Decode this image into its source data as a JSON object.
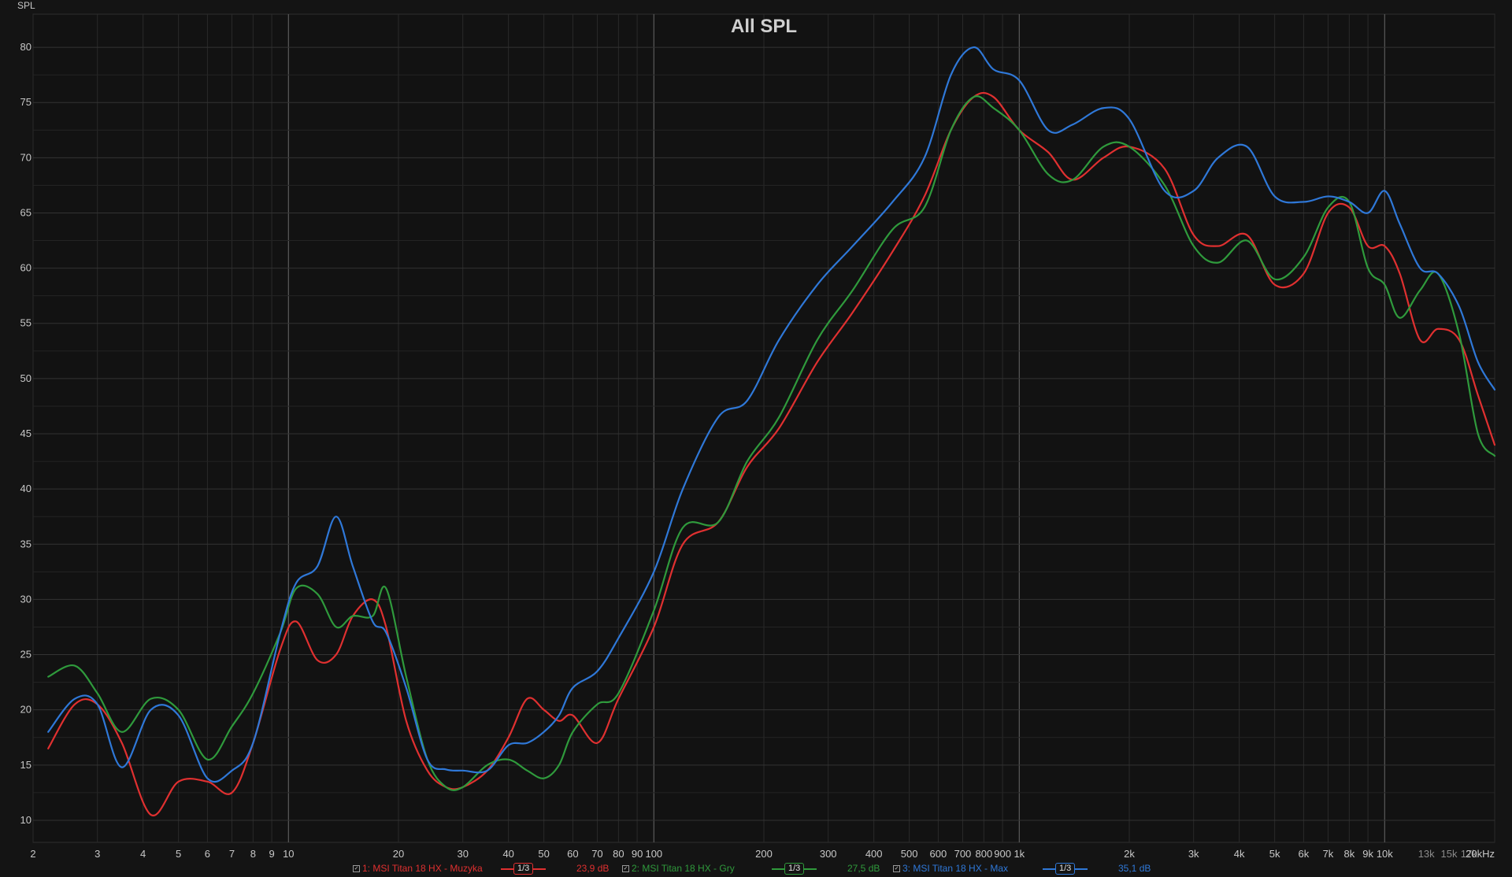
{
  "chart_data": {
    "type": "line",
    "title": "All SPL",
    "ylabel": "SPL",
    "xscale": "log",
    "xlim": [
      2,
      20000
    ],
    "ylim": [
      8,
      83
    ],
    "grid": true,
    "legend_position": "bottom",
    "yticks": [
      10,
      15,
      20,
      25,
      30,
      35,
      40,
      45,
      50,
      55,
      60,
      65,
      70,
      75,
      80
    ],
    "xticks": [
      {
        "v": 2,
        "t": "2"
      },
      {
        "v": 3,
        "t": "3"
      },
      {
        "v": 4,
        "t": "4"
      },
      {
        "v": 5,
        "t": "5"
      },
      {
        "v": 6,
        "t": "6"
      },
      {
        "v": 7,
        "t": "7"
      },
      {
        "v": 8,
        "t": "8"
      },
      {
        "v": 9,
        "t": "9"
      },
      {
        "v": 10,
        "t": "10"
      },
      {
        "v": 20,
        "t": "20"
      },
      {
        "v": 30,
        "t": "30"
      },
      {
        "v": 40,
        "t": "40"
      },
      {
        "v": 50,
        "t": "50"
      },
      {
        "v": 60,
        "t": "60"
      },
      {
        "v": 70,
        "t": "70"
      },
      {
        "v": 80,
        "t": "80"
      },
      {
        "v": 90,
        "t": "90"
      },
      {
        "v": 100,
        "t": "100"
      },
      {
        "v": 200,
        "t": "200"
      },
      {
        "v": 300,
        "t": "300"
      },
      {
        "v": 400,
        "t": "400"
      },
      {
        "v": 500,
        "t": "500"
      },
      {
        "v": 600,
        "t": "600"
      },
      {
        "v": 700,
        "t": "700"
      },
      {
        "v": 800,
        "t": "800"
      },
      {
        "v": 900,
        "t": "900"
      },
      {
        "v": 1000,
        "t": "1k"
      },
      {
        "v": 2000,
        "t": "2k"
      },
      {
        "v": 3000,
        "t": "3k"
      },
      {
        "v": 4000,
        "t": "4k"
      },
      {
        "v": 5000,
        "t": "5k"
      },
      {
        "v": 6000,
        "t": "6k"
      },
      {
        "v": 7000,
        "t": "7k"
      },
      {
        "v": 8000,
        "t": "8k"
      },
      {
        "v": 9000,
        "t": "9k"
      },
      {
        "v": 10000,
        "t": "10k"
      },
      {
        "v": 13000,
        "t": "13k",
        "dim": true
      },
      {
        "v": 15000,
        "t": "15k",
        "dim": true
      },
      {
        "v": 17000,
        "t": "17k",
        "dim": true
      },
      {
        "v": 20000,
        "t": "20kHz"
      }
    ],
    "x": [
      2.2,
      2.6,
      3.0,
      3.5,
      4.2,
      5.0,
      6.0,
      7.0,
      8.0,
      9.5,
      10.5,
      12,
      13.5,
      15,
      17,
      18.5,
      21,
      24,
      27,
      30,
      35,
      40,
      45,
      50,
      55,
      60,
      70,
      80,
      100,
      120,
      150,
      180,
      220,
      280,
      350,
      450,
      550,
      650,
      750,
      850,
      1000,
      1200,
      1400,
      1700,
      2000,
      2500,
      3000,
      3500,
      4200,
      5000,
      6000,
      7000,
      8000,
      9000,
      10000,
      11000,
      12500,
      14000,
      16000,
      18000,
      20000
    ],
    "series": [
      {
        "name": "1: MSI Titan 18 HX - Muzyka",
        "color": "#e03030",
        "values": [
          16.5,
          20.5,
          20.5,
          17.0,
          10.5,
          13.5,
          13.5,
          12.5,
          17.0,
          25.5,
          28.0,
          24.5,
          25.0,
          28.5,
          30.0,
          27.5,
          19.0,
          14.5,
          13.0,
          13.0,
          14.5,
          17.5,
          21.0,
          20.0,
          19.0,
          19.5,
          17.0,
          21.0,
          27.5,
          35.0,
          37.0,
          42.0,
          45.5,
          51.5,
          56.0,
          61.5,
          66.5,
          72.5,
          75.5,
          75.5,
          72.5,
          70.5,
          68.0,
          70.0,
          71.0,
          69.0,
          63.0,
          62.0,
          63.0,
          58.5,
          59.5,
          65.0,
          65.5,
          62.0,
          62.0,
          59.5,
          53.5,
          54.5,
          53.5,
          48.5,
          44.0
        ]
      },
      {
        "name": "2: MSI Titan 18 HX - Gry",
        "color": "#2f9a3c",
        "values": [
          23.0,
          24.0,
          21.5,
          18.0,
          21.0,
          20.0,
          15.5,
          18.5,
          21.5,
          27.0,
          31.0,
          30.5,
          27.5,
          28.5,
          28.5,
          31.0,
          23.0,
          15.5,
          13.0,
          13.0,
          15.0,
          15.5,
          14.5,
          13.8,
          15.0,
          18.0,
          20.5,
          21.5,
          29.0,
          36.5,
          37.0,
          42.5,
          46.5,
          53.5,
          58.0,
          63.5,
          65.5,
          72.5,
          75.5,
          74.5,
          72.5,
          68.5,
          68.0,
          71.0,
          71.0,
          67.5,
          62.0,
          60.5,
          62.5,
          59.0,
          61.0,
          65.5,
          66.0,
          60.0,
          58.5,
          55.5,
          58.0,
          59.5,
          54.0,
          45.0,
          43.0
        ]
      },
      {
        "name": "3: MSI Titan 18 HX - Max",
        "color": "#2f78d8",
        "values": [
          18.0,
          21.0,
          20.5,
          14.8,
          20.0,
          19.5,
          13.8,
          14.5,
          17.0,
          27.0,
          31.5,
          33.0,
          37.5,
          33.0,
          28.0,
          27.0,
          22.0,
          15.5,
          14.6,
          14.5,
          14.5,
          16.8,
          17.0,
          18.0,
          19.5,
          22.0,
          23.5,
          26.5,
          32.5,
          40.0,
          46.5,
          48.0,
          53.5,
          58.5,
          62.0,
          66.0,
          70.0,
          77.5,
          80.0,
          78.0,
          77.0,
          72.5,
          73.0,
          74.5,
          73.5,
          67.0,
          67.0,
          70.0,
          71.0,
          66.5,
          66.0,
          66.5,
          66.0,
          65.0,
          67.0,
          64.0,
          60.0,
          59.5,
          56.5,
          51.5,
          49.0
        ]
      }
    ]
  },
  "legend": [
    {
      "label": "1: MSI Titan 18 HX - Muzyka",
      "smoothing": "1/3",
      "value": "23,9 dB",
      "color": "#e03030"
    },
    {
      "label": "2: MSI Titan 18 HX - Gry",
      "smoothing": "1/3",
      "value": "27,5 dB",
      "color": "#2f9a3c"
    },
    {
      "label": "3: MSI Titan 18 HX - Max",
      "smoothing": "1/3",
      "value": "35,1 dB",
      "color": "#2f78d8"
    }
  ],
  "colors": {
    "background": "#141414",
    "plot_background": "#121212",
    "grid": "#2a2a2a"
  }
}
